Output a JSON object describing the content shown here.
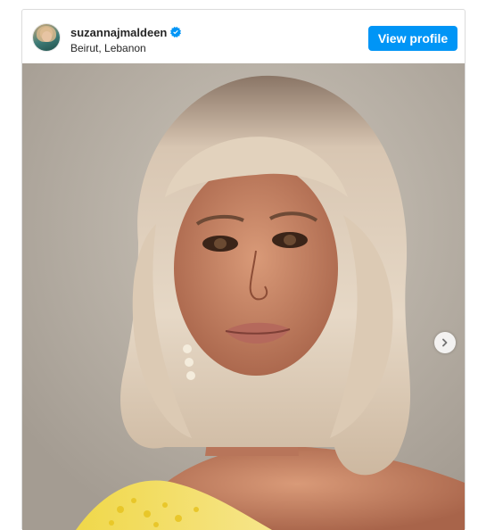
{
  "post": {
    "username": "suzannajmaldeen",
    "location": "Beirut, Lebanon",
    "verified": true,
    "view_profile_label": "View profile"
  },
  "icons": {
    "verified": "verified-badge-icon",
    "next": "chevron-right-icon"
  },
  "colors": {
    "accent": "#0095f6",
    "text": "#262626",
    "border": "#dbdbdb"
  }
}
